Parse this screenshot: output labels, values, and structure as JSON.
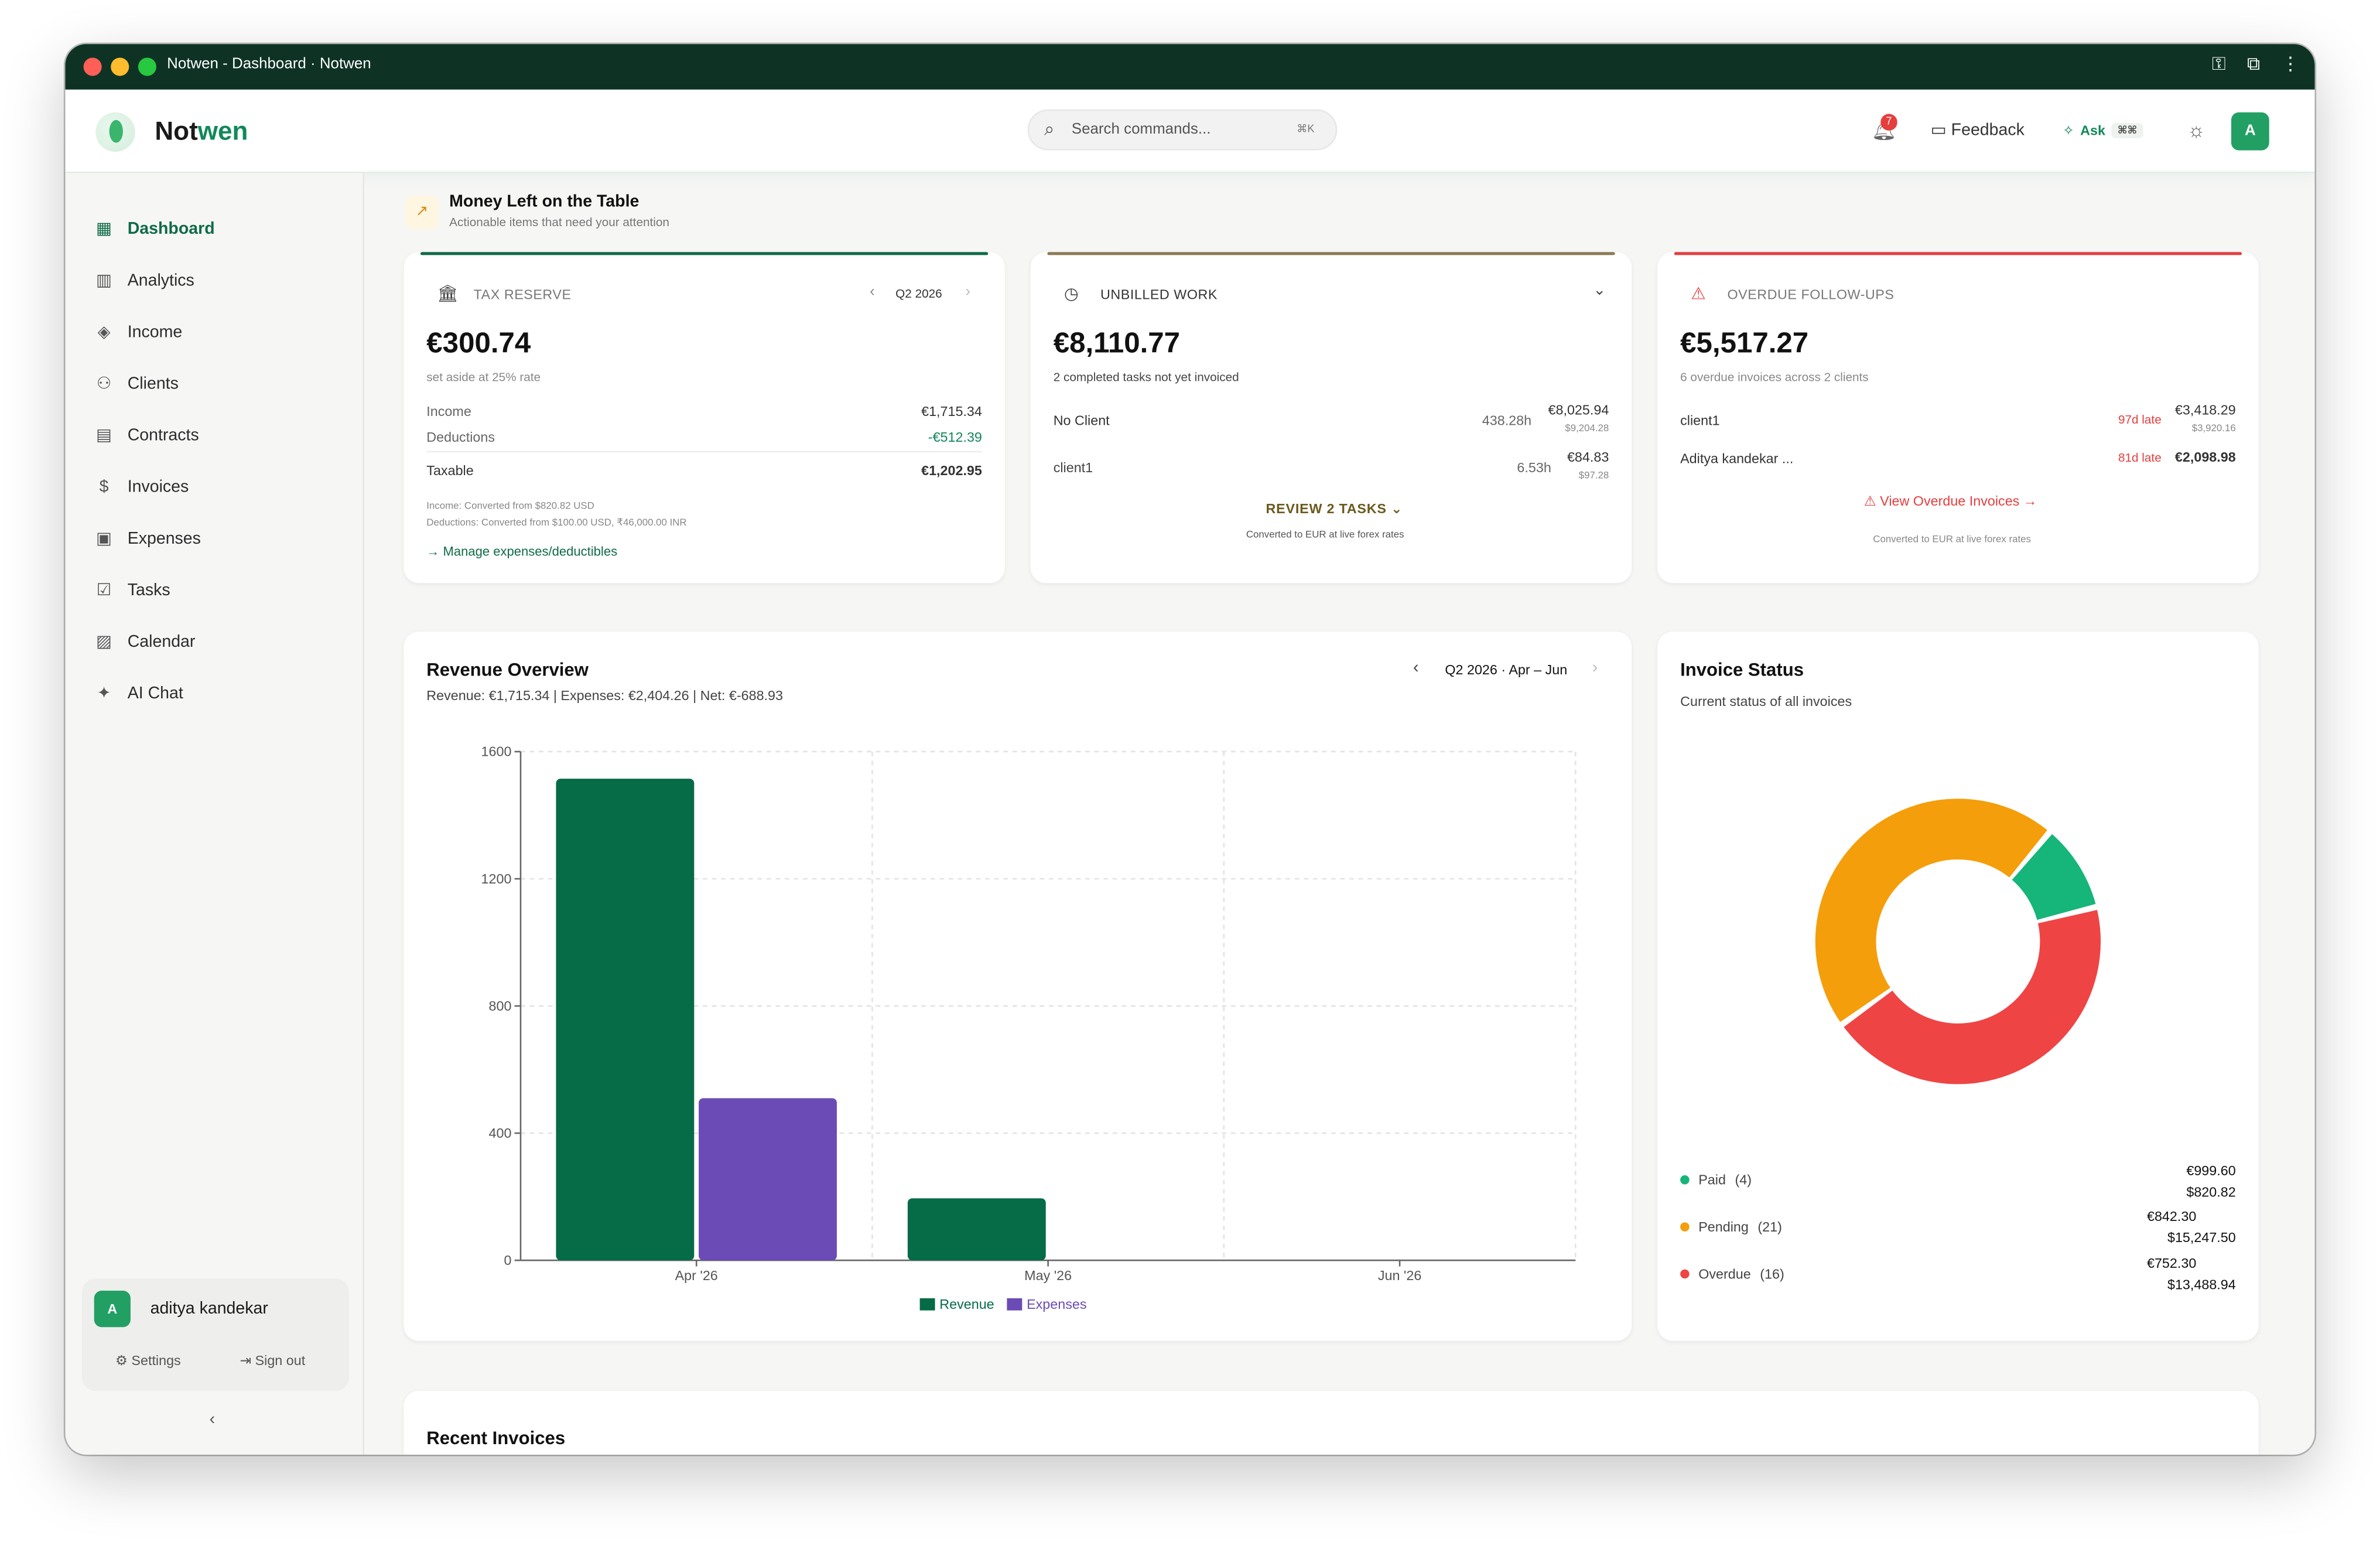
{
  "window": {
    "title": "Notwen - Dashboard · Notwen"
  },
  "header": {
    "brand_a": "Not",
    "brand_b": "wen",
    "search_placeholder": "Search commands...",
    "search_shortcut": "⌘K",
    "notifications_count": "7",
    "feedback_label": "Feedback",
    "ask_label": "Ask",
    "ask_shortcut": "⌘⌘",
    "avatar_initial": "A"
  },
  "sidebar": {
    "items": [
      {
        "label": "Dashboard",
        "icon": "dashboard-icon"
      },
      {
        "label": "Analytics",
        "icon": "bar-chart-icon"
      },
      {
        "label": "Income",
        "icon": "layers-icon"
      },
      {
        "label": "Clients",
        "icon": "users-icon"
      },
      {
        "label": "Contracts",
        "icon": "document-icon"
      },
      {
        "label": "Invoices",
        "icon": "dollar-circle-icon"
      },
      {
        "label": "Expenses",
        "icon": "receipt-icon"
      },
      {
        "label": "Tasks",
        "icon": "checkbox-icon"
      },
      {
        "label": "Calendar",
        "icon": "calendar-icon"
      },
      {
        "label": "AI Chat",
        "icon": "sparkles-icon"
      }
    ],
    "user": {
      "initial": "A",
      "name": "aditya kandekar",
      "settings": "Settings",
      "signout": "Sign out"
    }
  },
  "money": {
    "title": "Money Left on the Table",
    "subtitle": "Actionable items that need your attention"
  },
  "tax": {
    "label": "TAX RESERVE",
    "period": "Q2 2026",
    "amount": "€300.74",
    "sub": "set aside at 25% rate",
    "income_label": "Income",
    "income_value": "€1,715.34",
    "deductions_label": "Deductions",
    "deductions_value": "-€512.39",
    "taxable_label": "Taxable",
    "taxable_value": "€1,202.95",
    "note1": "Income: Converted from $820.82 USD",
    "note2": "Deductions: Converted from $100.00 USD, ₹46,000.00 INR",
    "link": "Manage expenses/deductibles"
  },
  "unbilled": {
    "label": "UNBILLED WORK",
    "amount": "€8,110.77",
    "sub": "2 completed tasks not yet invoiced",
    "rows": [
      {
        "name": "No Client",
        "hours": "438.28h",
        "value": "€8,025.94",
        "alt": "$9,204.28"
      },
      {
        "name": "client1",
        "hours": "6.53h",
        "value": "€84.83",
        "alt": "$97.28"
      }
    ],
    "review": "REVIEW 2 TASKS",
    "note": "Converted to EUR at live forex rates"
  },
  "overdue": {
    "label": "OVERDUE FOLLOW-UPS",
    "amount": "€5,517.27",
    "sub": "6 overdue invoices across 2 clients",
    "rows": [
      {
        "name": "client1",
        "late": "97d late",
        "value": "€3,418.29",
        "alt": "$3,920.16"
      },
      {
        "name": "Aditya kandekar ...",
        "late": "81d late",
        "value": "€2,098.98",
        "alt": ""
      }
    ],
    "link": "View Overdue Invoices",
    "note": "Converted to EUR at live forex rates"
  },
  "revenue": {
    "title": "Revenue Overview",
    "summary": "Revenue: €1,715.34 | Expenses: €2,404.26 | Net: €-688.93",
    "period": "Q2 2026 · Apr – Jun"
  },
  "chart_data": {
    "type": "bar",
    "title": "Revenue Overview",
    "categories": [
      "Apr '26",
      "May '26",
      "Jun '26"
    ],
    "series": [
      {
        "name": "Revenue",
        "values": [
          1515,
          195,
          0
        ],
        "color": "#066b47"
      },
      {
        "name": "Expenses",
        "values": [
          510,
          0,
          0
        ],
        "color": "#6b4bb6"
      }
    ],
    "yticks": [
      "0",
      "400",
      "800",
      "1200",
      "1600"
    ],
    "ylim": [
      0,
      1600
    ],
    "grid": true,
    "legend": "bottom"
  },
  "invoice_status": {
    "title": "Invoice Status",
    "subtitle": "Current status of all invoices",
    "items": [
      {
        "label": "Paid",
        "count": "(4)",
        "eur": "€999.60",
        "usd": "$820.82",
        "color": "#16b57a",
        "share": 0.1
      },
      {
        "label": "Pending",
        "count": "(21)",
        "eur": "€842.30",
        "usd": "$15,247.50",
        "color": "#f59e0b",
        "share": 0.46
      },
      {
        "label": "Overdue",
        "count": "(16)",
        "eur": "€752.30",
        "usd": "$13,488.94",
        "color": "#ef4444",
        "share": 0.44
      }
    ]
  },
  "recent": {
    "title": "Recent Invoices"
  }
}
